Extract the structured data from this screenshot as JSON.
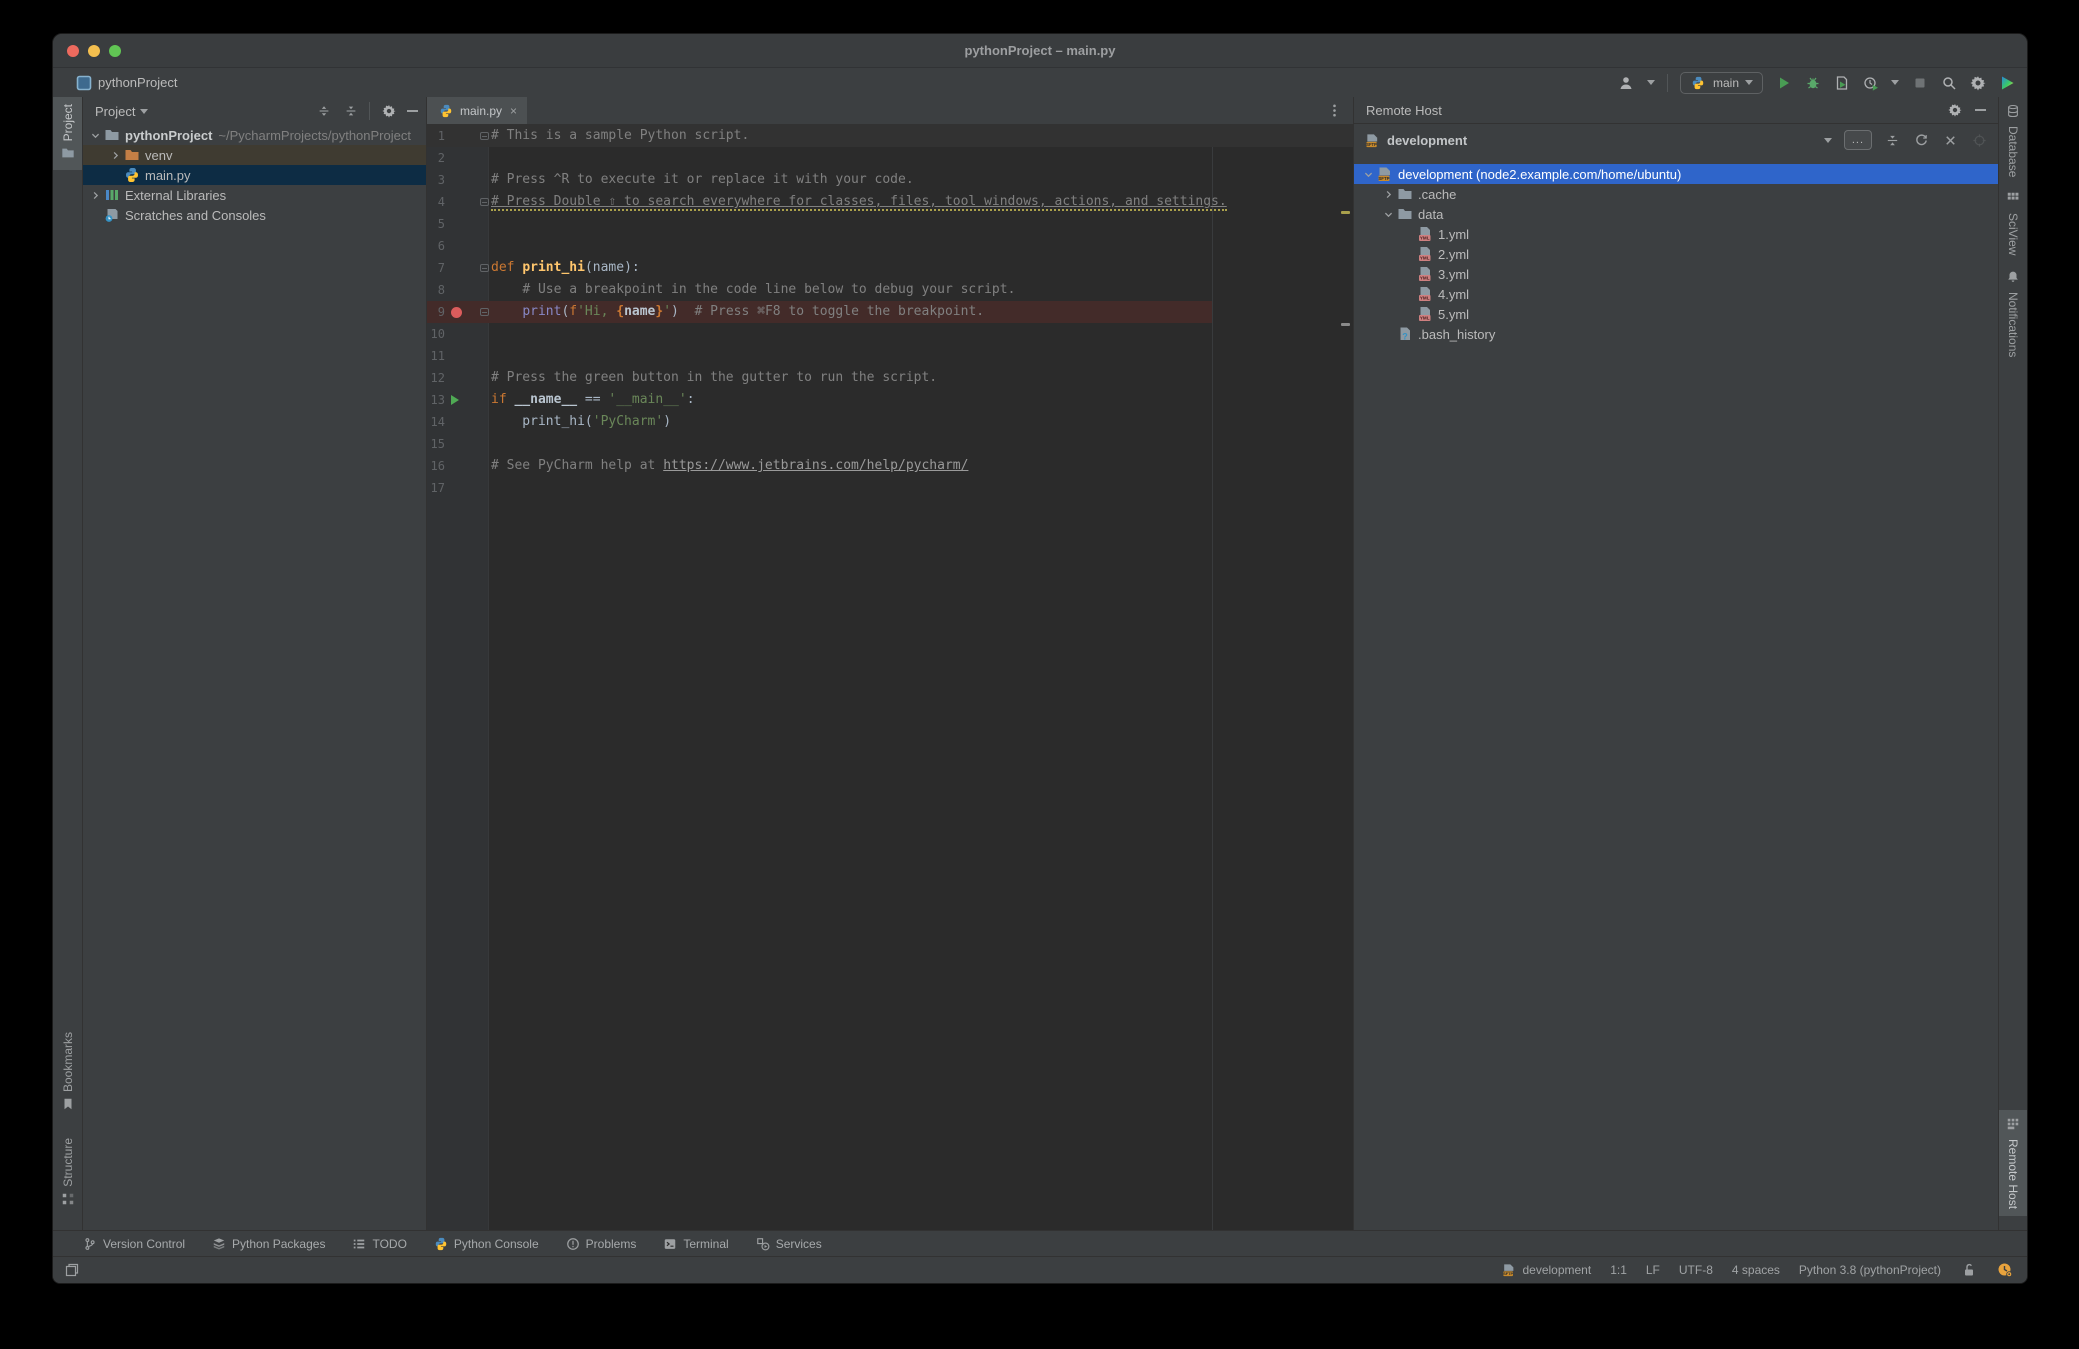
{
  "window": {
    "title": "pythonProject – main.py",
    "project_badge": "pythonProject",
    "traffic_lights": [
      "#ED6A5E",
      "#F4BF4F",
      "#61C554"
    ]
  },
  "toolbar": {
    "run_config": "main"
  },
  "left_stripe": {
    "top": [
      {
        "label": "Project",
        "icon": "folder",
        "active": true
      }
    ],
    "bottom": [
      {
        "label": "Bookmarks",
        "icon": "bookmark"
      },
      {
        "label": "Structure",
        "icon": "structure"
      }
    ]
  },
  "right_stripe": {
    "top": [
      {
        "label": "Database",
        "icon": "db"
      },
      {
        "label": "SciView",
        "icon": "grid"
      },
      {
        "label": "Notifications",
        "icon": "bell"
      }
    ],
    "bottom": [
      {
        "label": "Remote Host",
        "icon": "remote",
        "active": true
      }
    ]
  },
  "project_panel": {
    "title": "Project",
    "tree": [
      {
        "level": 0,
        "chevron": "down",
        "icon": "folder",
        "label": "pythonProject",
        "bold": true,
        "suffix": "~/PycharmProjects/pythonProject"
      },
      {
        "level": 1,
        "chevron": "right",
        "icon": "folder-o",
        "label": "venv",
        "bg": "hover"
      },
      {
        "level": 1,
        "chevron": "none",
        "icon": "py",
        "label": "main.py",
        "bg": "selected"
      },
      {
        "level": 0,
        "chevron": "right",
        "icon": "extlib",
        "label": "External Libraries"
      },
      {
        "level": 0,
        "chevron": "none",
        "icon": "scratch",
        "label": "Scratches and Consoles"
      }
    ]
  },
  "editor": {
    "tab": "main.py",
    "warning_count": "1",
    "lines": [
      {
        "n": "1",
        "hl": "caret",
        "gutter": [
          "fold"
        ],
        "seg": [
          [
            "c",
            "# This is a sample Python script."
          ]
        ]
      },
      {
        "n": "2",
        "seg": []
      },
      {
        "n": "3",
        "seg": [
          [
            "c",
            "# Press ^R to execute it or replace it with your code."
          ]
        ]
      },
      {
        "n": "4",
        "gutter": [
          "fold"
        ],
        "seg": [
          [
            "cu",
            "# Press Double ⇧ to search everywhere for classes, files, tool windows, actions, and settings."
          ]
        ]
      },
      {
        "n": "5",
        "seg": []
      },
      {
        "n": "6",
        "seg": []
      },
      {
        "n": "7",
        "gutter": [
          "fold"
        ],
        "seg": [
          [
            "k",
            "def "
          ],
          [
            "fn",
            "print_hi"
          ],
          [
            "d",
            "(name):"
          ]
        ]
      },
      {
        "n": "8",
        "seg": [
          [
            "d",
            "    "
          ],
          [
            "c",
            "# Use a breakpoint in the code line below to debug your script."
          ]
        ]
      },
      {
        "n": "9",
        "hl": "bp",
        "gutter": [
          "bp",
          "fold"
        ],
        "seg": [
          [
            "d",
            "    "
          ],
          [
            "b",
            "print"
          ],
          [
            "d",
            "("
          ],
          [
            "k",
            "f"
          ],
          [
            "s",
            "'Hi, "
          ],
          [
            "br",
            "{"
          ],
          [
            "bd",
            "name"
          ],
          [
            "br",
            "}"
          ],
          [
            "s",
            "'"
          ],
          [
            "d",
            ")  "
          ],
          [
            "c",
            "# Press ⌘F8 to toggle the breakpoint."
          ]
        ]
      },
      {
        "n": "10",
        "seg": []
      },
      {
        "n": "11",
        "seg": []
      },
      {
        "n": "12",
        "seg": [
          [
            "c",
            "# Press the green button in the gutter to run the script."
          ]
        ]
      },
      {
        "n": "13",
        "gutter": [
          "run"
        ],
        "seg": [
          [
            "k",
            "if "
          ],
          [
            "bd",
            "__name__"
          ],
          [
            "d",
            " == "
          ],
          [
            "s",
            "'__main__'"
          ],
          [
            "d",
            ":"
          ]
        ]
      },
      {
        "n": "14",
        "seg": [
          [
            "d",
            "    print_hi("
          ],
          [
            "s",
            "'PyCharm'"
          ],
          [
            "d",
            ")"
          ]
        ]
      },
      {
        "n": "15",
        "seg": []
      },
      {
        "n": "16",
        "seg": [
          [
            "c",
            "# See PyCharm help at "
          ],
          [
            "lnk",
            "https://www.jetbrains.com/help/pycharm/"
          ]
        ]
      },
      {
        "n": "17",
        "seg": []
      }
    ]
  },
  "remote_host": {
    "title": "Remote Host",
    "server": "development",
    "more_button": "...",
    "tree": [
      {
        "level": 0,
        "chevron": "down",
        "icon": "sftp",
        "label": "development (node2.example.com/home/ubuntu)",
        "bg": "blue"
      },
      {
        "level": 1,
        "chevron": "right",
        "icon": "folder",
        "label": ".cache"
      },
      {
        "level": 1,
        "chevron": "down",
        "icon": "folder",
        "label": "data"
      },
      {
        "level": 2,
        "chevron": "none",
        "icon": "yml",
        "label": "1.yml"
      },
      {
        "level": 2,
        "chevron": "none",
        "icon": "yml",
        "label": "2.yml"
      },
      {
        "level": 2,
        "chevron": "none",
        "icon": "yml",
        "label": "3.yml"
      },
      {
        "level": 2,
        "chevron": "none",
        "icon": "yml",
        "label": "4.yml"
      },
      {
        "level": 2,
        "chevron": "none",
        "icon": "yml",
        "label": "5.yml"
      },
      {
        "level": 1,
        "chevron": "none",
        "icon": "fileq",
        "label": ".bash_history"
      }
    ]
  },
  "bottom_bar": {
    "items": [
      {
        "label": "Version Control",
        "icon": "branch"
      },
      {
        "label": "Python Packages",
        "icon": "packages"
      },
      {
        "label": "TODO",
        "icon": "todo"
      },
      {
        "label": "Python Console",
        "icon": "py"
      },
      {
        "label": "Problems",
        "icon": "problems"
      },
      {
        "label": "Terminal",
        "icon": "terminal"
      },
      {
        "label": "Services",
        "icon": "services"
      }
    ]
  },
  "status_bar": {
    "host": "development",
    "caret": "1:1",
    "line_ending": "LF",
    "encoding": "UTF-8",
    "indent": "4 spaces",
    "interpreter": "Python 3.8 (pythonProject)"
  },
  "colors": {
    "selection_blue": "#2f65ca",
    "selected_file_row": "#0d2c44",
    "breakpoint_line": "#432b29",
    "caret_line": "#323232",
    "run_green": "#499C54",
    "breakpoint_red": "#db5c5c"
  }
}
